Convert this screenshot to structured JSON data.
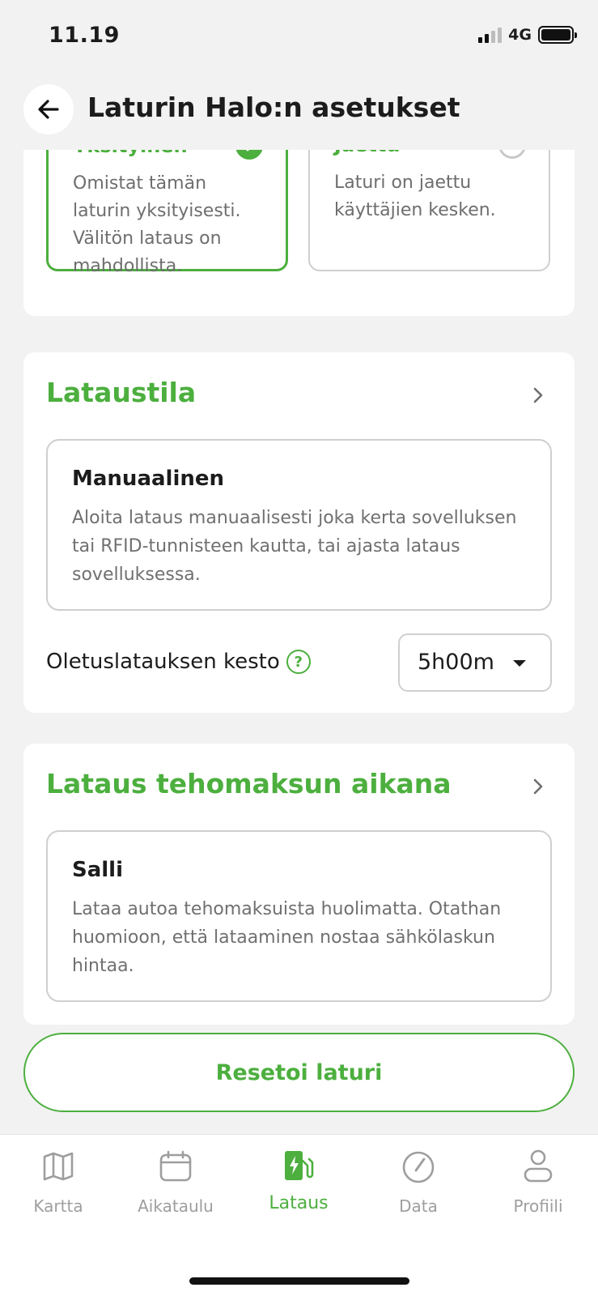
{
  "status_bar": {
    "time": "11.19",
    "network": "4G"
  },
  "header": {
    "title": "Laturin Halo:n asetukset"
  },
  "ownership": {
    "options": [
      {
        "title": "Yksityinen",
        "description": "Omistat tämän laturin yksityisesti. Välitön lataus on mahdollista.",
        "selected": true
      },
      {
        "title": "Jaettu",
        "description": "Laturi on jaettu käyttäjien kesken.",
        "selected": false
      }
    ]
  },
  "charging_mode": {
    "title": "Lataustila",
    "selected_title": "Manuaalinen",
    "selected_description": "Aloita lataus manuaalisesti joka kerta sovelluksen tai RFID-tunnisteen kautta, tai ajasta lataus sovelluksessa.",
    "duration_label": "Oletuslatauksen kesto",
    "duration_value": "5h00m"
  },
  "power_fee": {
    "title": "Lataus tehomaksun aikana",
    "selected_title": "Salli",
    "selected_description": "Lataa autoa tehomaksuista huolimatta. Otathan huomioon, että lataaminen nostaa sähkölaskun hintaa."
  },
  "reset_button": "Resetoi laturi",
  "tabs": [
    {
      "label": "Kartta",
      "icon": "map-icon",
      "active": false
    },
    {
      "label": "Aikataulu",
      "icon": "calendar-icon",
      "active": false
    },
    {
      "label": "Lataus",
      "icon": "charging-station-icon",
      "active": true
    },
    {
      "label": "Data",
      "icon": "gauge-icon",
      "active": false
    },
    {
      "label": "Profiili",
      "icon": "profile-icon",
      "active": false
    }
  ],
  "colors": {
    "accent": "#4caf3e",
    "background": "#f2f2f2",
    "muted_text": "#707070"
  }
}
